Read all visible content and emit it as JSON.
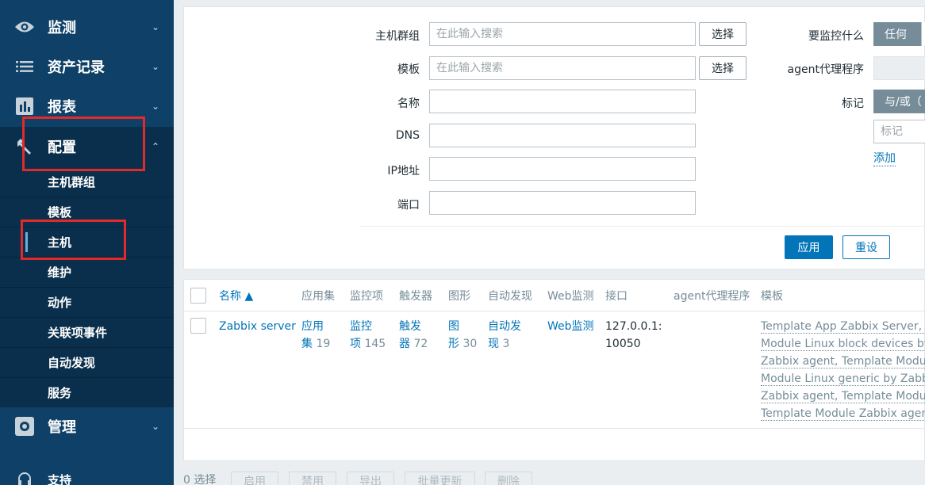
{
  "sidebar": {
    "items": [
      {
        "label": "监测",
        "icon": "eye-icon"
      },
      {
        "label": "资产记录",
        "icon": "list-icon"
      },
      {
        "label": "报表",
        "icon": "bar-chart-icon"
      },
      {
        "label": "配置",
        "icon": "wrench-icon"
      },
      {
        "label": "管理",
        "icon": "gear-icon"
      },
      {
        "label": "支持",
        "icon": "headset-icon"
      }
    ],
    "config_submenu": [
      "主机群组",
      "模板",
      "主机",
      "维护",
      "动作",
      "关联项事件",
      "自动发现",
      "服务"
    ],
    "selected_submenu": "主机"
  },
  "filter": {
    "host_group_label": "主机群组",
    "host_group_placeholder": "在此输入搜索",
    "template_label": "模板",
    "template_placeholder": "在此输入搜索",
    "select_button": "选择",
    "name_label": "名称",
    "dns_label": "DNS",
    "ip_label": "IP地址",
    "port_label": "端口",
    "monitor_what_label": "要监控什么",
    "monitor_what_value": "任何",
    "proxy_label": "agent代理程序",
    "tags_label": "标记",
    "tags_operator": "与/或（",
    "tag_placeholder": "标记",
    "add_link": "添加",
    "apply_button": "应用",
    "reset_button": "重设"
  },
  "table": {
    "headers": [
      "名称 ▲",
      "应用集",
      "监控项",
      "触发器",
      "图形",
      "自动发现",
      "Web监测",
      "接口",
      "agent代理程序",
      "模板"
    ],
    "row": {
      "name": "Zabbix server",
      "apps_label_1": "应用",
      "apps_label_2": "集",
      "apps_count": "19",
      "items_label_1": "监控",
      "items_label_2": "项",
      "items_count": "145",
      "triggers_label_1": "触发",
      "triggers_label_2": "器",
      "triggers_count": "72",
      "graphs_label_1": "图",
      "graphs_label_2": "形",
      "graphs_count": "30",
      "discovery_label_1": "自动发",
      "discovery_label_2": "现",
      "discovery_count": "3",
      "web": "Web监测",
      "interface_line1": "127.0.0.1:",
      "interface_line2": "10050",
      "templates": [
        "Template App Zabbix Server, Te",
        "Module Linux block devices by",
        "Zabbix agent, Template Module",
        "Module Linux generic by Zabbix",
        "Zabbix agent, Template Module",
        "Template Module Zabbix agent)"
      ]
    }
  },
  "footer": {
    "selected_count": "0 选择",
    "buttons": [
      "启用",
      "禁用",
      "导出",
      "批量更新",
      "删除"
    ]
  },
  "colors": {
    "sidebar": "#0f4168",
    "sidebar_active": "#0a2f4c",
    "primary": "#0275b8",
    "highlight_box": "#e32a2a"
  }
}
